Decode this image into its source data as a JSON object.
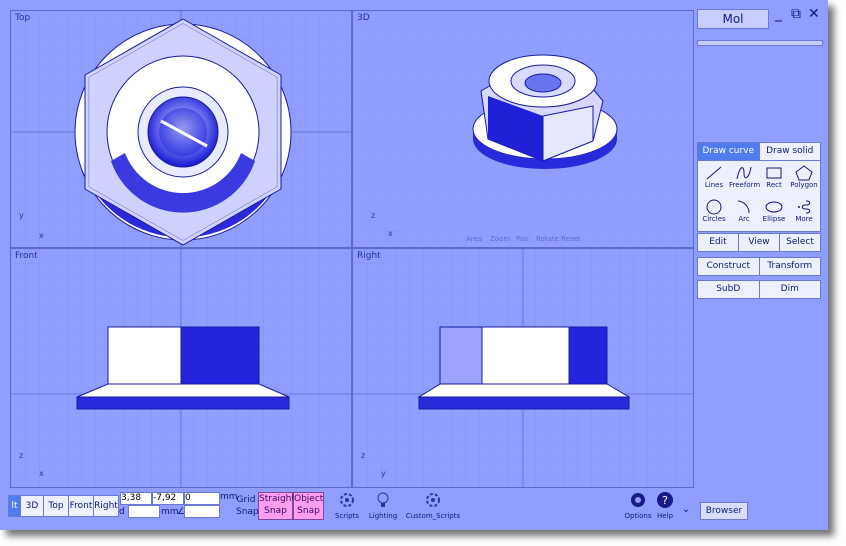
{
  "viewports": {
    "top": {
      "label": "Top",
      "x_axis": "x",
      "y_axis": "y"
    },
    "three_d": {
      "label": "3D",
      "x_axis": "x",
      "z_axis": "z"
    },
    "front": {
      "label": "Front",
      "x_axis": "x",
      "z_axis": "z"
    },
    "right": {
      "label": "Right",
      "x_axis": "y",
      "z_axis": "z"
    }
  },
  "nav_tools": [
    "Area",
    "Zoom",
    "Pan",
    "Rotate",
    "Reset"
  ],
  "sidebar": {
    "mol_label": "Mol",
    "tabs": [
      {
        "label": "Draw curve",
        "active": true
      },
      {
        "label": "Draw solid",
        "active": false
      }
    ],
    "tools": [
      {
        "label": "Lines",
        "icon": "line-icon"
      },
      {
        "label": "Freeform",
        "icon": "freeform-icon"
      },
      {
        "label": "Rect",
        "icon": "rect-icon"
      },
      {
        "label": "Polygon",
        "icon": "polygon-icon"
      },
      {
        "label": "Circles",
        "icon": "circle-icon"
      },
      {
        "label": "Arc",
        "icon": "arc-icon"
      },
      {
        "label": "Ellipse",
        "icon": "ellipse-icon"
      },
      {
        "label": "More",
        "icon": "more-icon"
      }
    ],
    "row1": [
      "Edit",
      "View",
      "Select"
    ],
    "row2": [
      "Construct",
      "Transform"
    ],
    "row3": [
      "SubD",
      "Dim"
    ]
  },
  "bottom": {
    "view_buttons": [
      "lt",
      "3D",
      "Top",
      "Front",
      "Right"
    ],
    "coord_x": "3,38",
    "coord_y": "-7,92",
    "coord_z": "0",
    "unit": "mm",
    "d_label": "d",
    "mm_label": "mm",
    "angle_label": "∠",
    "grid_snap": [
      "Grid",
      "Snap"
    ],
    "straight_snap": [
      "Straight",
      "Snap"
    ],
    "object_snap": [
      "Object",
      "Snap"
    ],
    "scripts": "Scripts",
    "lighting": "Lighting",
    "custom_scripts": "Custom_Scripts",
    "options": "Options",
    "help": "Help",
    "browser": "Browser"
  },
  "colors": {
    "background": "#8f9eff",
    "accent": "#4f7df0",
    "snap": "#ff9ef0"
  }
}
